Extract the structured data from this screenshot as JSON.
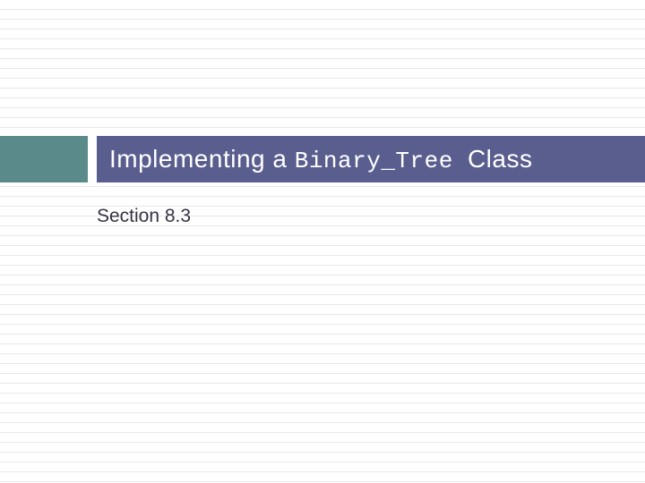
{
  "slide": {
    "title_part1": "Implementing a ",
    "title_code": "Binary_Tree ",
    "title_part2": "Class",
    "subtitle": "Section 8.3"
  },
  "colors": {
    "accent": "#5a8a8a",
    "title_bar": "#5a5e8f",
    "text": "#333344"
  }
}
